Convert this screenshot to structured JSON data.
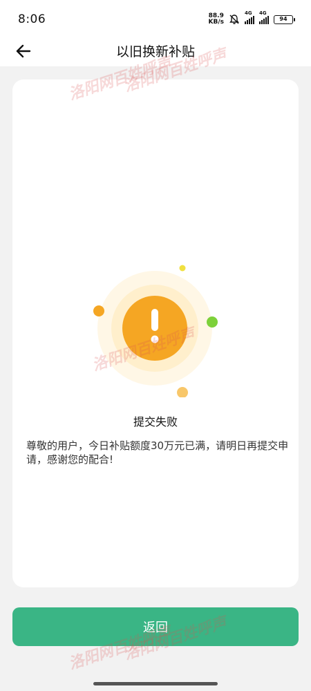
{
  "status_bar": {
    "time": "8:06",
    "net_speed_value": "88.9",
    "net_speed_unit": "KB/s",
    "signal_1_tag": "4G",
    "signal_2_tag": "4G",
    "battery": "94"
  },
  "header": {
    "back_icon": "arrow-left-icon",
    "title": "以旧换新补贴"
  },
  "result": {
    "icon": "exclamation-icon",
    "title": "提交失败",
    "message": "尊敬的用户，今日补贴额度30万元已满，请明日再提交申请，感谢您的配合!"
  },
  "actions": {
    "return_label": "返回"
  },
  "watermark": {
    "site": "洛阳网",
    "column": "百姓呼声"
  },
  "colors": {
    "accent_green": "#3ab585",
    "warning_orange": "#f5a623",
    "card_background": "#ffffff",
    "page_background": "#f2f2f2"
  }
}
